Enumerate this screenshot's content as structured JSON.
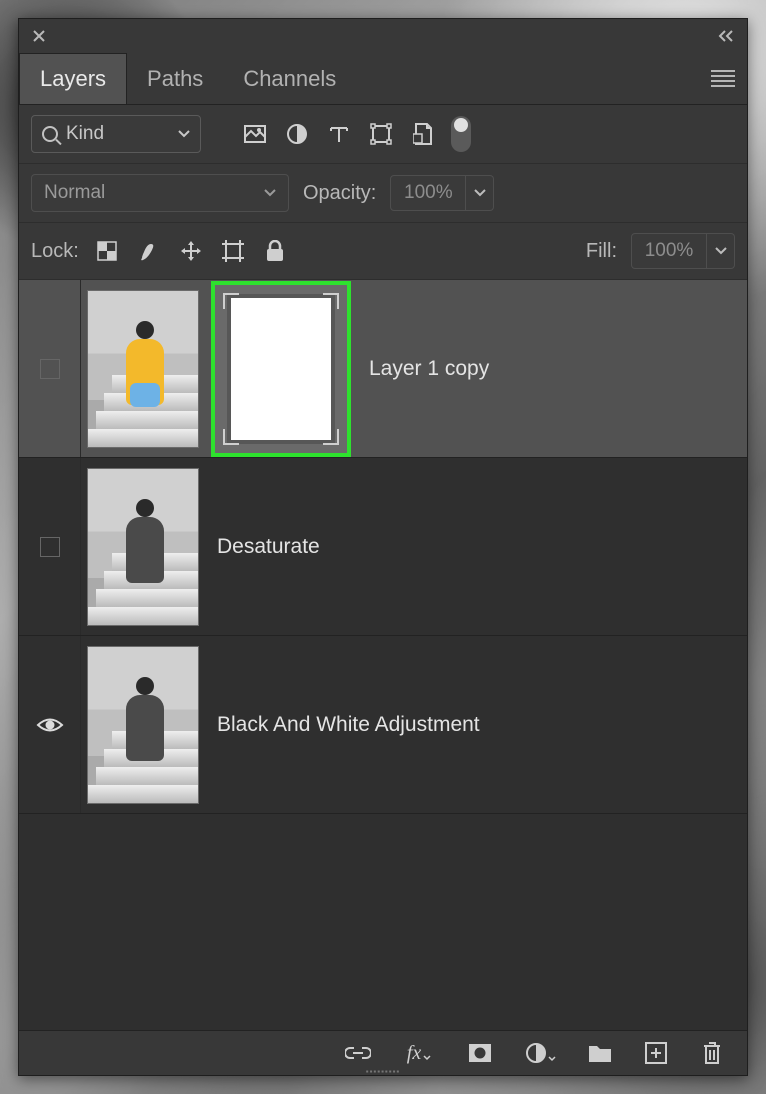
{
  "tabs": {
    "layers": "Layers",
    "paths": "Paths",
    "channels": "Channels"
  },
  "filter": {
    "label": "Kind"
  },
  "blend": {
    "mode": "Normal",
    "opacity_label": "Opacity:",
    "opacity_value": "100%"
  },
  "lock": {
    "label": "Lock:",
    "fill_label": "Fill:",
    "fill_value": "100%"
  },
  "layers": {
    "l1": "Layer 1 copy",
    "l2": "Desaturate",
    "l3": "Black And White Adjustment"
  }
}
